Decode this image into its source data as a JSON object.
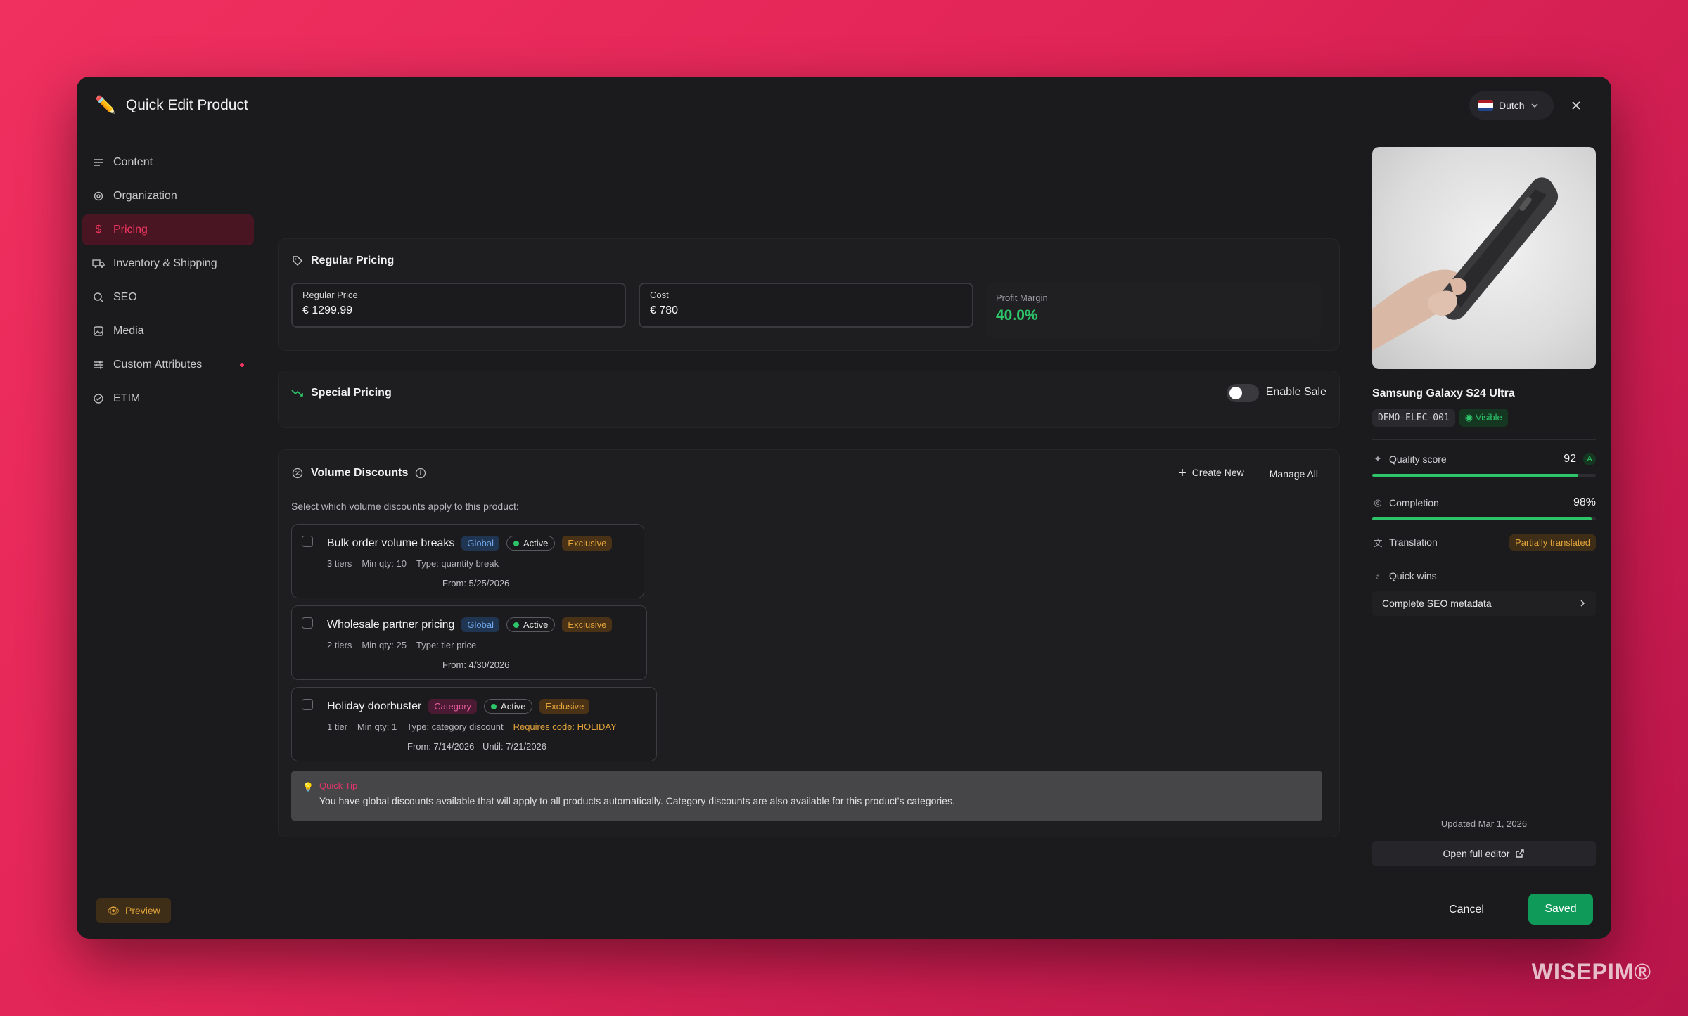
{
  "header": {
    "title_icon": "pencil-icon",
    "title": "Quick Edit Product",
    "language": "Dutch",
    "flag_colors": [
      "#ae1c28",
      "#ffffff",
      "#21468b"
    ]
  },
  "sidebar": {
    "items": [
      {
        "label": "Content",
        "icon": "lines-icon"
      },
      {
        "label": "Organization",
        "icon": "gear-icon"
      },
      {
        "label": "Pricing",
        "icon": "dollar-icon"
      },
      {
        "label": "Inventory & Shipping",
        "icon": "truck-icon"
      },
      {
        "label": "SEO",
        "icon": "search-icon"
      },
      {
        "label": "Media",
        "icon": "image-icon"
      },
      {
        "label": "Custom Attributes",
        "icon": "sliders-icon"
      },
      {
        "label": "ETIM",
        "icon": "check-circle-icon"
      }
    ],
    "active": "Pricing",
    "preview_label": "Preview"
  },
  "regular_pricing": {
    "title": "Regular Pricing",
    "regular_price_label": "Regular Price",
    "regular_price_value": "€  1299.99",
    "cost_label": "Cost",
    "cost_value": "€  780",
    "margin_label": "Profit Margin",
    "margin_value": "40.0%"
  },
  "special_pricing": {
    "title": "Special Pricing",
    "toggle_label": "Enable Sale",
    "enabled": false
  },
  "volume_discounts": {
    "title": "Volume Discounts",
    "create_label": "Create New",
    "manage_label": "Manage All",
    "subtitle": "Select which volume discounts apply to this product:",
    "items": [
      {
        "name": "Bulk order volume breaks",
        "scope": "Global",
        "status": "Active",
        "exclusive": "Exclusive",
        "tiers": "3 tiers",
        "min_qty": "Min qty: 10",
        "type": "Type: quantity break",
        "requires": "",
        "dates": "From: 5/25/2026"
      },
      {
        "name": "Wholesale partner pricing",
        "scope": "Global",
        "status": "Active",
        "exclusive": "Exclusive",
        "tiers": "2 tiers",
        "min_qty": "Min qty: 25",
        "type": "Type: tier price",
        "requires": "",
        "dates": "From: 4/30/2026"
      },
      {
        "name": "Holiday doorbuster",
        "scope": "Category",
        "status": "Active",
        "exclusive": "Exclusive",
        "tiers": "1 tier",
        "min_qty": "Min qty: 1",
        "type": "Type: category discount",
        "requires": "Requires code: HOLIDAY",
        "dates": "From: 7/14/2026 - Until: 7/21/2026"
      }
    ],
    "tip_title": "Quick Tip",
    "tip_text": "You have global discounts available that will apply to all products automatically. Category discounts are also available for this product's categories."
  },
  "product": {
    "name": "Samsung Galaxy S24 Ultra",
    "sku": "DEMO-ELEC-001",
    "visibility": "Visible",
    "quality_label": "Quality score",
    "quality_value": "92",
    "quality_grade": "A",
    "quality_fraction": 0.92,
    "completion_label": "Completion",
    "completion_value": "98%",
    "completion_fraction": 0.98,
    "translation_label": "Translation",
    "translation_status": "Partially translated",
    "quick_wins_label": "Quick wins",
    "quick_wins": [
      "Complete SEO metadata"
    ],
    "updated": "Updated Mar 1, 2026",
    "open_full_label": "Open full editor"
  },
  "footer": {
    "cancel_label": "Cancel",
    "saved_label": "Saved"
  },
  "watermark": "WISEPIM®",
  "colors": {
    "accent": "#f0365f",
    "success": "#2ec56a",
    "warning": "#e2a43a",
    "primary_button": "#0f9a5a"
  }
}
